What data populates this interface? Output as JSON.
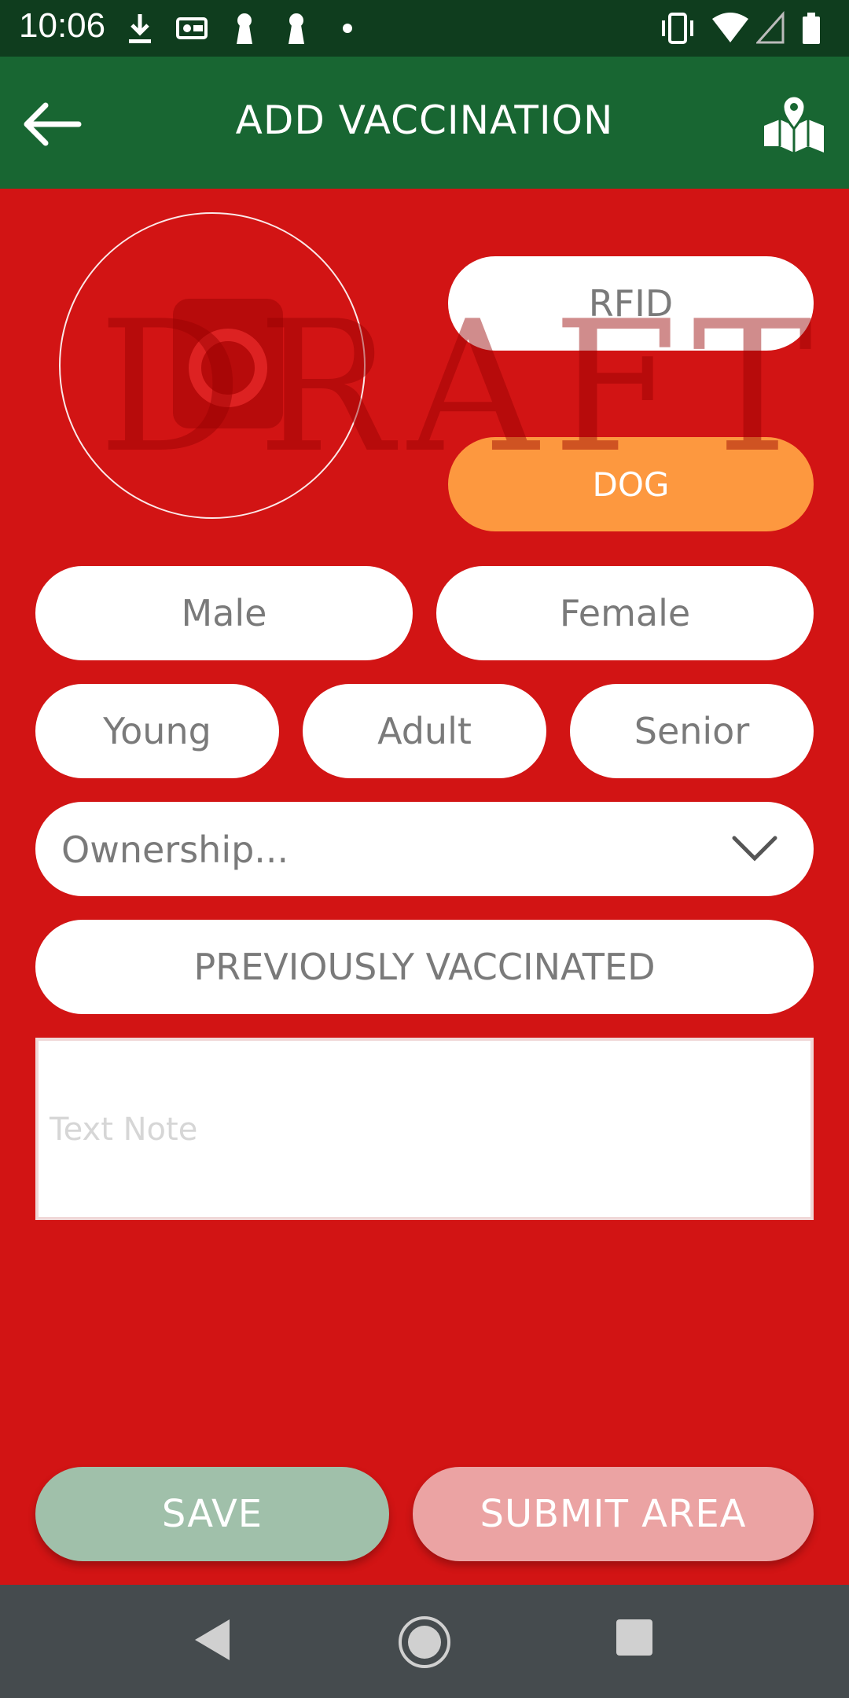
{
  "status_bar": {
    "time": "10:06",
    "icons": [
      "download-icon",
      "vpn-icon",
      "keyhole-icon",
      "keyhole-icon",
      "dot-icon",
      "vibrate-icon",
      "wifi-icon",
      "signal-icon",
      "battery-icon"
    ]
  },
  "app_bar": {
    "title": "ADD VACCINATION",
    "back_icon": "arrow-left-icon",
    "map_icon": "map-pin-icon"
  },
  "photo": {
    "icon": "camera-icon"
  },
  "watermark": {
    "text": "DRAFT"
  },
  "fields": {
    "rfid_label": "RFID",
    "species_label": "DOG",
    "sex_options": [
      "Male",
      "Female"
    ],
    "age_options": [
      "Young",
      "Adult",
      "Senior"
    ],
    "ownership_placeholder": "Ownership...",
    "previously_vaccinated_label": "PREVIOUSLY VACCINATED",
    "text_note_placeholder": "Text Note"
  },
  "actions": {
    "save_label": "SAVE",
    "submit_label": "SUBMIT AREA"
  },
  "colors": {
    "background": "#d21414",
    "app_bar": "#186632",
    "status_bar": "#0f3d1e",
    "species_selected": "#fd983f",
    "save_button": "#a0c0aa",
    "submit_button": "#eba3a3",
    "nav_bar": "#454b4e"
  },
  "nav_bar": {
    "icons": [
      "nav-back-icon",
      "nav-home-icon",
      "nav-recents-icon"
    ]
  }
}
